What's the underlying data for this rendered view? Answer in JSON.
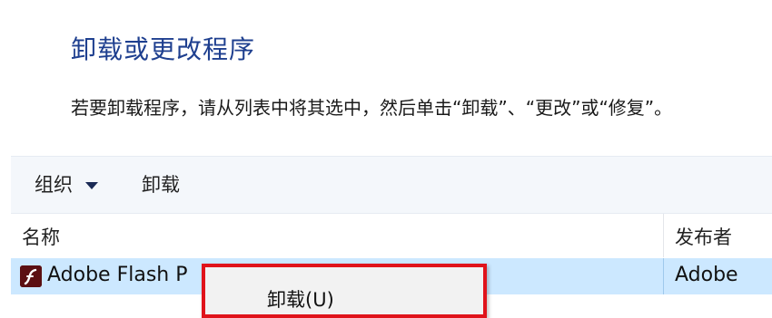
{
  "header": {
    "title": "卸载或更改程序",
    "instruction": "若要卸载程序，请从列表中将其选中，然后单击“卸载”、“更改”或“修复”。"
  },
  "toolbar": {
    "organize_label": "组织",
    "uninstall_label": "卸载"
  },
  "list": {
    "columns": {
      "name": "名称",
      "publisher": "发布者"
    },
    "rows": [
      {
        "name": "Adobe Flash P",
        "publisher": "Adobe",
        "icon": "adobe-flash-icon",
        "selected": true
      }
    ]
  },
  "context_menu": {
    "items": [
      {
        "label": "卸载(U)"
      }
    ],
    "highlight_color": "#e0131b"
  },
  "colors": {
    "title": "#1e3f8f",
    "toolbar_bg": "#f4f7fb",
    "selection_bg": "#cce8ff"
  }
}
